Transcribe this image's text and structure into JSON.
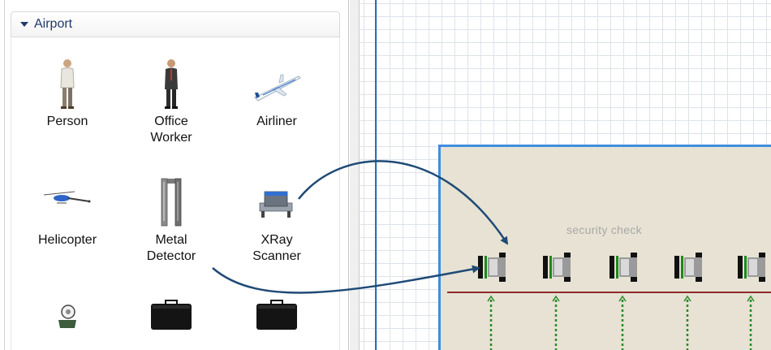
{
  "palette": {
    "section_title": "Airport",
    "items": [
      {
        "label": "Person",
        "icon": "person-icon"
      },
      {
        "label": "Office Worker",
        "icon": "office-worker-icon"
      },
      {
        "label": "Airliner",
        "icon": "airliner-icon"
      },
      {
        "label": "Helicopter",
        "icon": "helicopter-icon"
      },
      {
        "label": "Metal Detector",
        "icon": "metal-detector-icon"
      },
      {
        "label": "XRay Scanner",
        "icon": "xray-scanner-icon"
      },
      {
        "label": "",
        "icon": "camera-icon"
      },
      {
        "label": "",
        "icon": "suitcase-icon"
      },
      {
        "label": "",
        "icon": "suitcase-icon"
      }
    ]
  },
  "canvas": {
    "area_title": "security check"
  },
  "colors": {
    "accent": "#3e8ede",
    "arrow": "#1f4a76",
    "conveyor": "#8e2a2a",
    "flow_arrow": "#2a8a2a"
  }
}
